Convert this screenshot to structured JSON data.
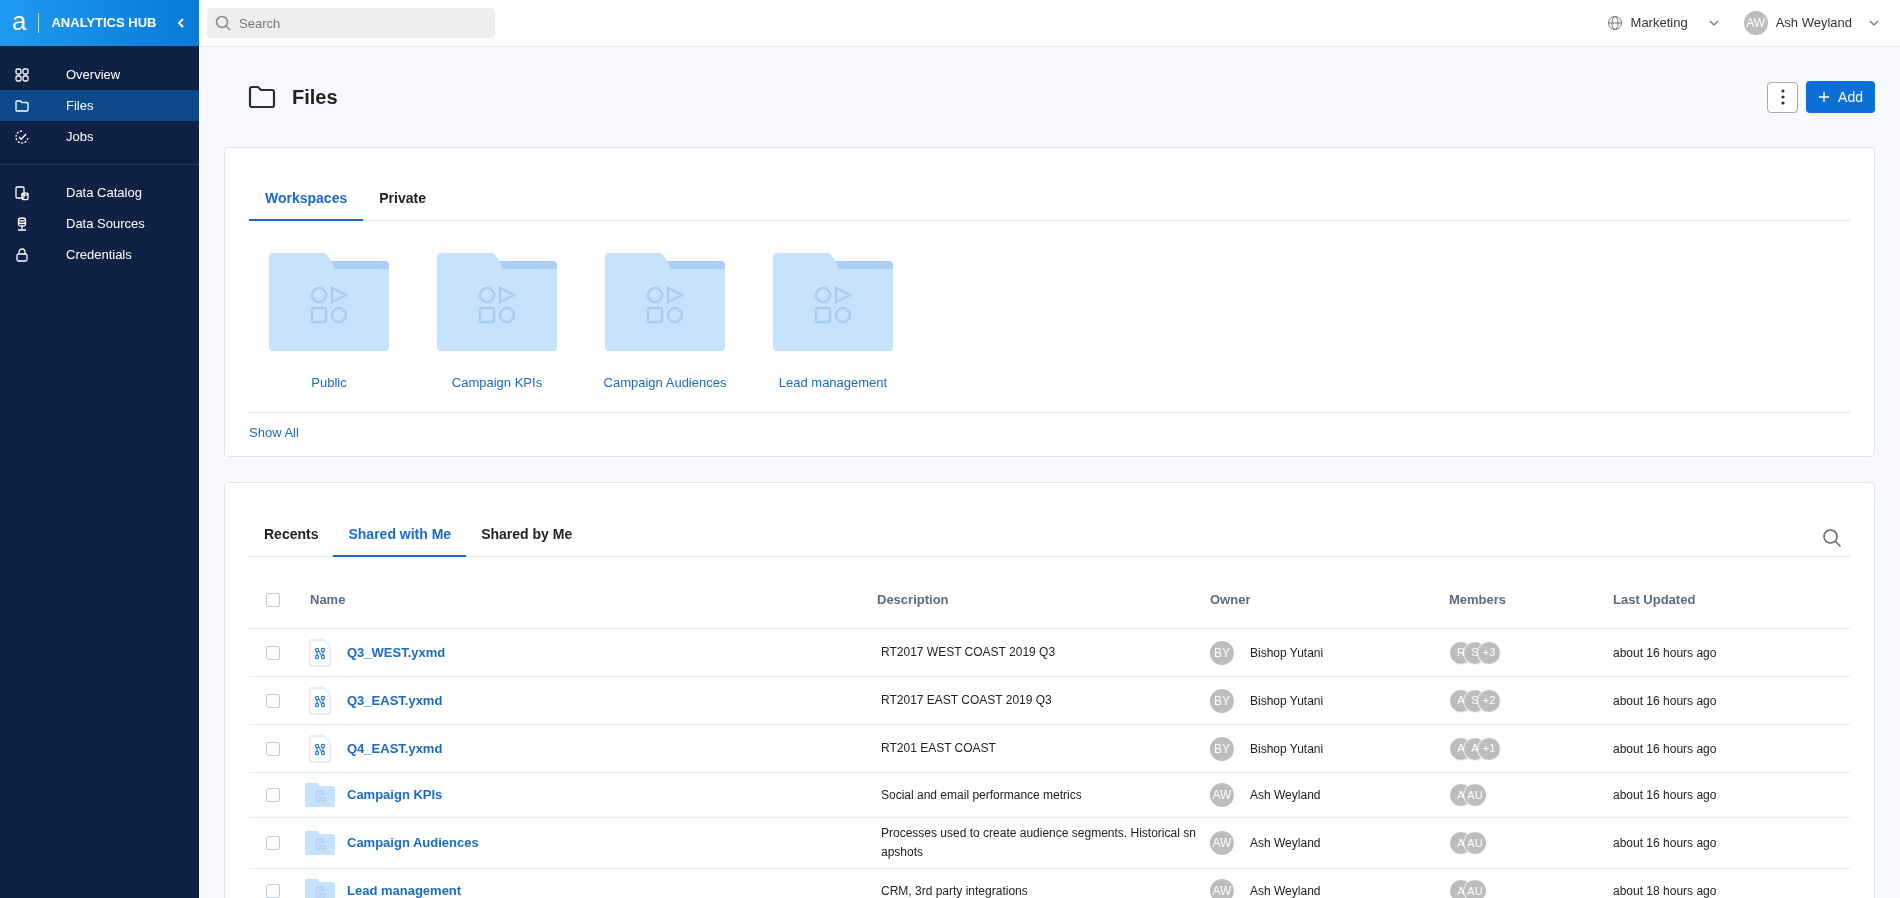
{
  "sidebar": {
    "logo": "a",
    "title": "ANALYTICS HUB",
    "groups": [
      [
        {
          "label": "Overview",
          "selected": false
        },
        {
          "label": "Files",
          "selected": true
        },
        {
          "label": "Jobs",
          "selected": false
        }
      ],
      [
        {
          "label": "Data Catalog",
          "selected": false
        },
        {
          "label": "Data Sources",
          "selected": false
        },
        {
          "label": "Credentials",
          "selected": false
        }
      ]
    ]
  },
  "topbar": {
    "search": {
      "placeholder": "Search"
    },
    "workspace": "Marketing",
    "user": {
      "initials": "AW",
      "name": "Ash Weyland"
    }
  },
  "page": {
    "title": "Files",
    "add_button": "Add"
  },
  "workspaces": {
    "tabs": [
      {
        "label": "Workspaces",
        "selected": true
      },
      {
        "label": "Private",
        "selected": false
      }
    ],
    "folders": [
      "Public",
      "Campaign KPIs",
      "Campaign Audiences",
      "Lead management"
    ],
    "show_all": "Show All"
  },
  "files": {
    "tabs": [
      {
        "label": "Recents",
        "selected": false
      },
      {
        "label": "Shared with Me",
        "selected": true
      },
      {
        "label": "Shared by Me",
        "selected": false
      }
    ],
    "table": {
      "select_all": {
        "checked": false
      },
      "columns": [
        "Name",
        "Description",
        "Owner",
        "Members",
        "Last Updated"
      ],
      "rows": [
        {
          "kind": "workflow",
          "checked": false,
          "name": "Q3_WEST.yxmd",
          "description": "RT2017 WEST COAST 2019 Q3",
          "owner": {
            "initials": "BY",
            "name": "Bishop Yutani"
          },
          "members": [
            "R",
            "S",
            "+3"
          ],
          "updated": "about 16 hours ago"
        },
        {
          "kind": "workflow",
          "checked": false,
          "name": "Q3_EAST.yxmd",
          "description": "RT2017 EAST COAST 2019 Q3",
          "owner": {
            "initials": "BY",
            "name": "Bishop Yutani"
          },
          "members": [
            "A",
            "S",
            "+2"
          ],
          "updated": "about 16 hours ago"
        },
        {
          "kind": "workflow",
          "checked": false,
          "name": "Q4_EAST.yxmd",
          "description": "RT201 EAST COAST",
          "owner": {
            "initials": "BY",
            "name": "Bishop Yutani"
          },
          "members": [
            "A",
            "A",
            "+1"
          ],
          "updated": "about 16 hours ago"
        },
        {
          "kind": "folder",
          "checked": false,
          "name": "Campaign KPIs",
          "description": "Social and email performance metrics",
          "owner": {
            "initials": "AW",
            "name": "Ash Weyland"
          },
          "members": [
            "A",
            "AU"
          ],
          "updated": "about 16 hours ago"
        },
        {
          "kind": "folder",
          "checked": false,
          "name": "Campaign Audiences",
          "description": "Processes used to create audience segments.  Historical snapshots",
          "owner": {
            "initials": "AW",
            "name": "Ash Weyland"
          },
          "members": [
            "A",
            "AU"
          ],
          "updated": "about 16 hours ago"
        },
        {
          "kind": "folder",
          "checked": false,
          "name": "Lead management",
          "description": "CRM, 3rd party integrations",
          "owner": {
            "initials": "AW",
            "name": "Ash Weyland"
          },
          "members": [
            "A",
            "AU"
          ],
          "updated": "about 18 hours ago"
        }
      ]
    }
  }
}
